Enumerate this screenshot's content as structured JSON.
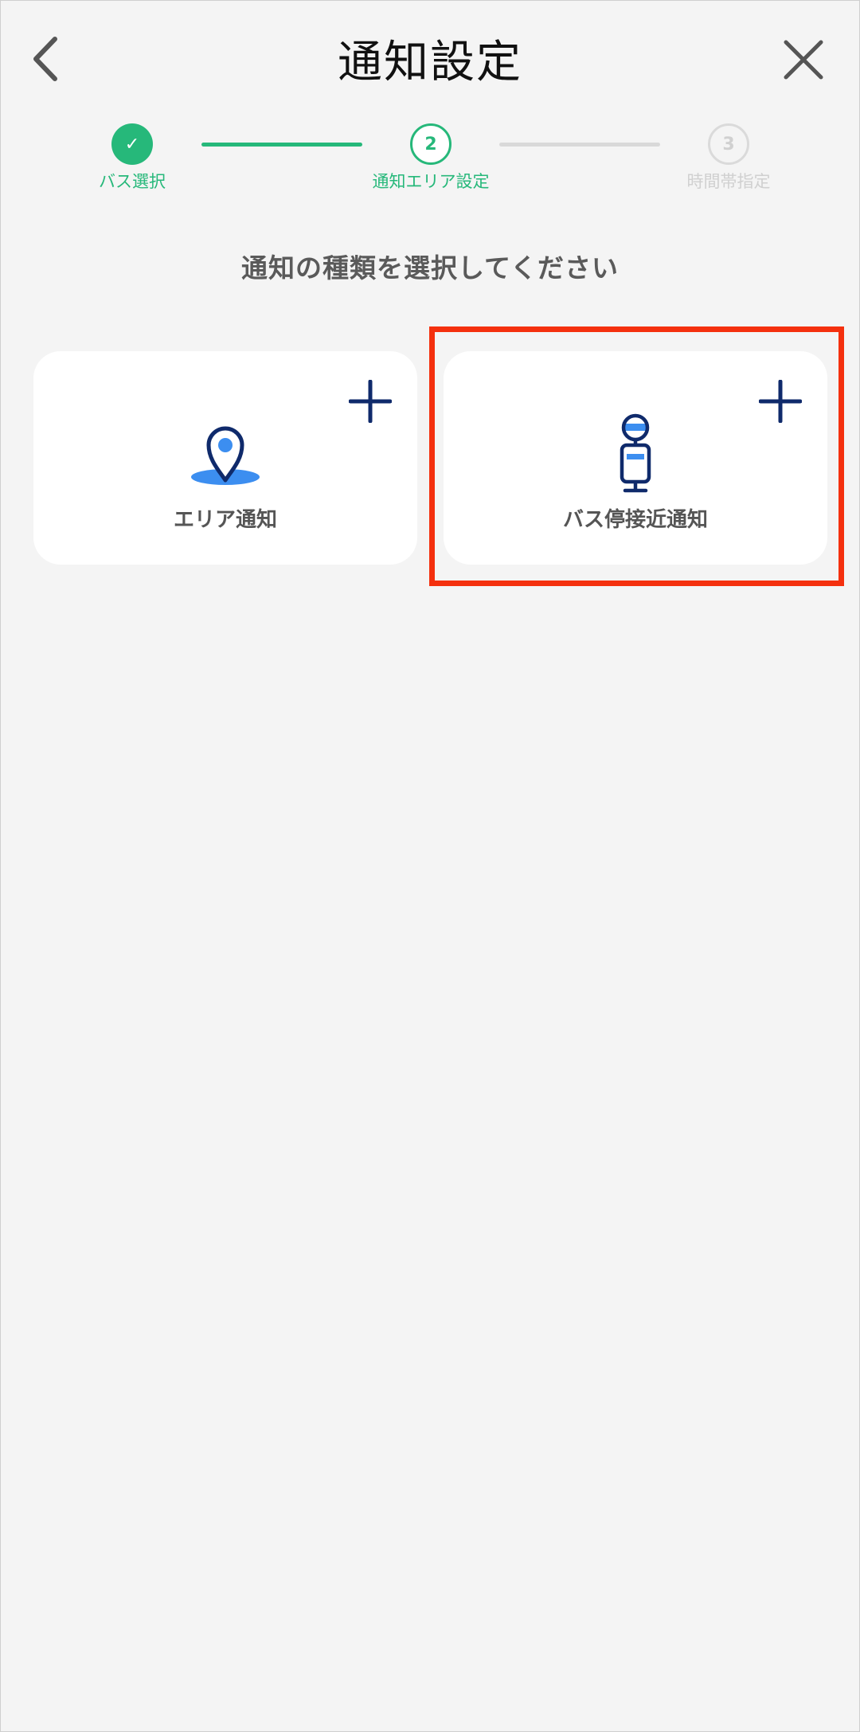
{
  "header": {
    "title": "通知設定",
    "back_icon": "chevron-left-icon",
    "close_icon": "close-icon"
  },
  "stepper": {
    "steps": [
      {
        "number": "✓",
        "label": "バス選択",
        "state": "done"
      },
      {
        "number": "2",
        "label": "通知エリア設定",
        "state": "active"
      },
      {
        "number": "3",
        "label": "時間帯指定",
        "state": "todo"
      }
    ],
    "colors": {
      "done": "#26b87a",
      "todo": "#d9d9d9"
    }
  },
  "main": {
    "section_title": "通知の種類を選択してください",
    "cards": [
      {
        "label": "エリア通知",
        "icon": "map-pin-icon",
        "action_icon": "plus-icon"
      },
      {
        "label": "バス停接近通知",
        "icon": "bus-stop-icon",
        "action_icon": "plus-icon"
      }
    ]
  },
  "colors": {
    "accent": "#26b87a",
    "icon_navy": "#0f2a6b",
    "icon_blue": "#3c8ef0",
    "highlight": "#f4300e"
  }
}
